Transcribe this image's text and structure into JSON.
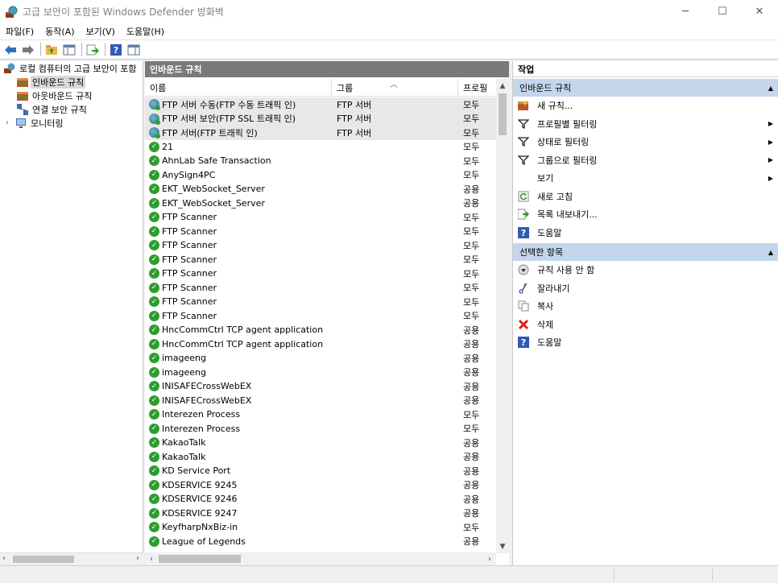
{
  "window": {
    "title": "고급 보안이 포함된 Windows Defender 방화벽"
  },
  "menu": [
    "파일(F)",
    "동작(A)",
    "보기(V)",
    "도움말(H)"
  ],
  "tree": {
    "root": "로컬 컴퓨터의 고급 보안이 포함",
    "items": [
      "인바운드 규칙",
      "아웃바운드 규칙",
      "연결 보안 규칙",
      "모니터링"
    ]
  },
  "center": {
    "header": "인바운드 규칙",
    "columns": {
      "name": "이름",
      "group": "그룹",
      "profile": "프로필"
    },
    "rows": [
      {
        "name": "FTP 서버 수동(FTP 수동 트래픽 인)",
        "group": "FTP 서버",
        "profile": "모두",
        "icon": "globe"
      },
      {
        "name": "FTP 서버 보안(FTP SSL 트래픽 인)",
        "group": "FTP 서버",
        "profile": "모두",
        "icon": "globe"
      },
      {
        "name": "FTP 서버(FTP 트래픽 인)",
        "group": "FTP 서버",
        "profile": "모두",
        "icon": "globe"
      },
      {
        "name": "21",
        "group": "",
        "profile": "모두",
        "icon": "ok"
      },
      {
        "name": "AhnLab Safe Transaction",
        "group": "",
        "profile": "모두",
        "icon": "ok"
      },
      {
        "name": "AnySign4PC",
        "group": "",
        "profile": "모두",
        "icon": "ok"
      },
      {
        "name": "EKT_WebSocket_Server",
        "group": "",
        "profile": "공용",
        "icon": "ok"
      },
      {
        "name": "EKT_WebSocket_Server",
        "group": "",
        "profile": "공용",
        "icon": "ok"
      },
      {
        "name": "FTP Scanner",
        "group": "",
        "profile": "모두",
        "icon": "ok"
      },
      {
        "name": "FTP Scanner",
        "group": "",
        "profile": "모두",
        "icon": "ok"
      },
      {
        "name": "FTP Scanner",
        "group": "",
        "profile": "모두",
        "icon": "ok"
      },
      {
        "name": "FTP Scanner",
        "group": "",
        "profile": "모두",
        "icon": "ok"
      },
      {
        "name": "FTP Scanner",
        "group": "",
        "profile": "모두",
        "icon": "ok"
      },
      {
        "name": "FTP Scanner",
        "group": "",
        "profile": "모두",
        "icon": "ok"
      },
      {
        "name": "FTP Scanner",
        "group": "",
        "profile": "모두",
        "icon": "ok"
      },
      {
        "name": "FTP Scanner",
        "group": "",
        "profile": "모두",
        "icon": "ok"
      },
      {
        "name": "HncCommCtrl TCP agent application",
        "group": "",
        "profile": "공용",
        "icon": "ok"
      },
      {
        "name": "HncCommCtrl TCP agent application",
        "group": "",
        "profile": "공용",
        "icon": "ok"
      },
      {
        "name": "imageeng",
        "group": "",
        "profile": "공용",
        "icon": "ok"
      },
      {
        "name": "imageeng",
        "group": "",
        "profile": "공용",
        "icon": "ok"
      },
      {
        "name": "INISAFECrossWebEX",
        "group": "",
        "profile": "공용",
        "icon": "ok"
      },
      {
        "name": "INISAFECrossWebEX",
        "group": "",
        "profile": "공용",
        "icon": "ok"
      },
      {
        "name": "Interezen Process",
        "group": "",
        "profile": "모두",
        "icon": "ok"
      },
      {
        "name": "Interezen Process",
        "group": "",
        "profile": "모두",
        "icon": "ok"
      },
      {
        "name": "KakaoTalk",
        "group": "",
        "profile": "공용",
        "icon": "ok"
      },
      {
        "name": "KakaoTalk",
        "group": "",
        "profile": "공용",
        "icon": "ok"
      },
      {
        "name": "KD Service Port",
        "group": "",
        "profile": "공용",
        "icon": "ok"
      },
      {
        "name": "KDSERVICE 9245",
        "group": "",
        "profile": "공용",
        "icon": "ok"
      },
      {
        "name": "KDSERVICE 9246",
        "group": "",
        "profile": "공용",
        "icon": "ok"
      },
      {
        "name": "KDSERVICE 9247",
        "group": "",
        "profile": "공용",
        "icon": "ok"
      },
      {
        "name": "KeyfharpNxBiz-in",
        "group": "",
        "profile": "모두",
        "icon": "ok"
      },
      {
        "name": "League of Legends",
        "group": "",
        "profile": "공용",
        "icon": "ok"
      }
    ]
  },
  "actions": {
    "title": "작업",
    "section1": "인바운드 규칙",
    "items1": [
      {
        "label": "새 규칙...",
        "icon": "new-rule-icon",
        "submenu": false
      },
      {
        "label": "프로필별 필터링",
        "icon": "filter-icon",
        "submenu": true
      },
      {
        "label": "상태로 필터링",
        "icon": "filter-icon",
        "submenu": true
      },
      {
        "label": "그룹으로 필터링",
        "icon": "filter-icon",
        "submenu": true
      },
      {
        "label": "보기",
        "icon": "",
        "submenu": true
      },
      {
        "label": "새로 고침",
        "icon": "refresh-icon",
        "submenu": false
      },
      {
        "label": "목록 내보내기...",
        "icon": "export-icon",
        "submenu": false
      },
      {
        "label": "도움말",
        "icon": "help-icon",
        "submenu": false
      }
    ],
    "section2": "선택한 항목",
    "items2": [
      {
        "label": "규칙 사용 안 함",
        "icon": "disable-icon"
      },
      {
        "label": "잘라내기",
        "icon": "cut-icon"
      },
      {
        "label": "복사",
        "icon": "copy-icon"
      },
      {
        "label": "삭제",
        "icon": "delete-icon"
      },
      {
        "label": "도움말",
        "icon": "help-icon"
      }
    ]
  }
}
